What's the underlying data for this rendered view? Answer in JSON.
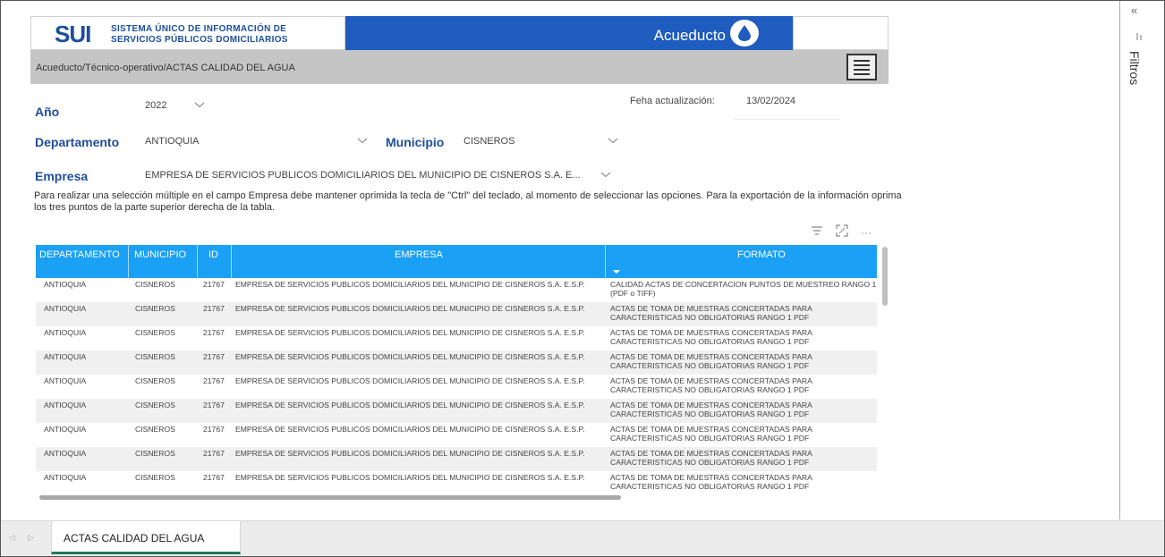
{
  "banner": {
    "logo_text": "SUI",
    "org_line1": "SISTEMA ÚNICO DE INFORMACIÓN DE",
    "org_line2": "SERVICIOS PÚBLICOS DOMICILIARIOS",
    "service": "Acueducto"
  },
  "breadcrumb": "Acueducto/Técnico-operativo/ACTAS CALIDAD DEL AGUA",
  "filters": {
    "year_label": "Año",
    "year_value": "2022",
    "department_label": "Departamento",
    "department_value": "ANTIOQUIA",
    "municipality_label": "Municipio",
    "municipality_value": "CISNEROS",
    "company_label": "Empresa",
    "company_value": "EMPRESA DE SERVICIOS PUBLICOS DOMICILIARIOS DEL MUNICIPIO DE CISNEROS S.A. E...",
    "update_label": "Feha actualización:",
    "update_value": "13/02/2024"
  },
  "instructions": "Para realizar una selección múltiple en el campo Empresa debe mantener oprimida la tecla de \"Ctrl\" del teclado, al momento de seleccionar las opciones. Para la exportación de la información oprima los tres puntos de la parte superior derecha de la tabla.",
  "toolbar": {
    "more_label": "···"
  },
  "table": {
    "columns": [
      "DEPARTAMENTO",
      "MUNICIPIO",
      "ID",
      "EMPRESA",
      "FORMATO"
    ],
    "rows": [
      [
        "ANTIOQUIA",
        "CISNEROS",
        "21767",
        "EMPRESA DE SERVICIOS PUBLICOS DOMICILIARIOS DEL MUNICIPIO DE CISNEROS S.A. E.S.P.",
        "CALIDAD ACTAS DE CONCERTACION PUNTOS DE MUESTREO RANGO 1 (PDF o TIFF)"
      ],
      [
        "ANTIOQUIA",
        "CISNEROS",
        "21767",
        "EMPRESA DE SERVICIOS PUBLICOS DOMICILIARIOS DEL MUNICIPIO DE CISNEROS S.A. E.S.P.",
        "ACTAS DE TOMA DE MUESTRAS CONCERTADAS PARA CARACTERISTICAS NO OBLIGATORIAS RANGO 1 PDF"
      ],
      [
        "ANTIOQUIA",
        "CISNEROS",
        "21767",
        "EMPRESA DE SERVICIOS PUBLICOS DOMICILIARIOS DEL MUNICIPIO DE CISNEROS S.A. E.S.P.",
        "ACTAS DE TOMA DE MUESTRAS CONCERTADAS PARA CARACTERISTICAS NO OBLIGATORIAS RANGO 1 PDF"
      ],
      [
        "ANTIOQUIA",
        "CISNEROS",
        "21767",
        "EMPRESA DE SERVICIOS PUBLICOS DOMICILIARIOS DEL MUNICIPIO DE CISNEROS S.A. E.S.P.",
        "ACTAS DE TOMA DE MUESTRAS CONCERTADAS PARA CARACTERISTICAS NO OBLIGATORIAS RANGO 1 PDF"
      ],
      [
        "ANTIOQUIA",
        "CISNEROS",
        "21767",
        "EMPRESA DE SERVICIOS PUBLICOS DOMICILIARIOS DEL MUNICIPIO DE CISNEROS S.A. E.S.P.",
        "ACTAS DE TOMA DE MUESTRAS CONCERTADAS PARA CARACTERISTICAS NO OBLIGATORIAS RANGO 1 PDF"
      ],
      [
        "ANTIOQUIA",
        "CISNEROS",
        "21767",
        "EMPRESA DE SERVICIOS PUBLICOS DOMICILIARIOS DEL MUNICIPIO DE CISNEROS S.A. E.S.P.",
        "ACTAS DE TOMA DE MUESTRAS CONCERTADAS PARA CARACTERISTICAS NO OBLIGATORIAS RANGO 1 PDF"
      ],
      [
        "ANTIOQUIA",
        "CISNEROS",
        "21767",
        "EMPRESA DE SERVICIOS PUBLICOS DOMICILIARIOS DEL MUNICIPIO DE CISNEROS S.A. E.S.P.",
        "ACTAS DE TOMA DE MUESTRAS CONCERTADAS PARA CARACTERISTICAS NO OBLIGATORIAS RANGO 1 PDF"
      ],
      [
        "ANTIOQUIA",
        "CISNEROS",
        "21767",
        "EMPRESA DE SERVICIOS PUBLICOS DOMICILIARIOS DEL MUNICIPIO DE CISNEROS S.A. E.S.P.",
        "ACTAS DE TOMA DE MUESTRAS CONCERTADAS PARA CARACTERISTICAS NO OBLIGATORIAS RANGO 1 PDF"
      ],
      [
        "ANTIOQUIA",
        "CISNEROS",
        "21767",
        "EMPRESA DE SERVICIOS PUBLICOS DOMICILIARIOS DEL MUNICIPIO DE CISNEROS S.A. E.S.P.",
        "ACTAS DE TOMA DE MUESTRAS CONCERTADAS PARA CARACTERISTICAS NO OBLIGATORIAS RANGO 1 PDF"
      ]
    ]
  },
  "right_pane": {
    "collapse_glyph": "«",
    "filters_label": "Filtros"
  },
  "tabs": [
    {
      "label": "ACTAS CALIDAD DEL AGUA",
      "active": true
    }
  ],
  "colors": {
    "banner_blue": "#1f5cbf",
    "table_header": "#1aa0f5",
    "label_blue": "#1f4e9c",
    "active_tab_underline": "#1f7a5c"
  }
}
